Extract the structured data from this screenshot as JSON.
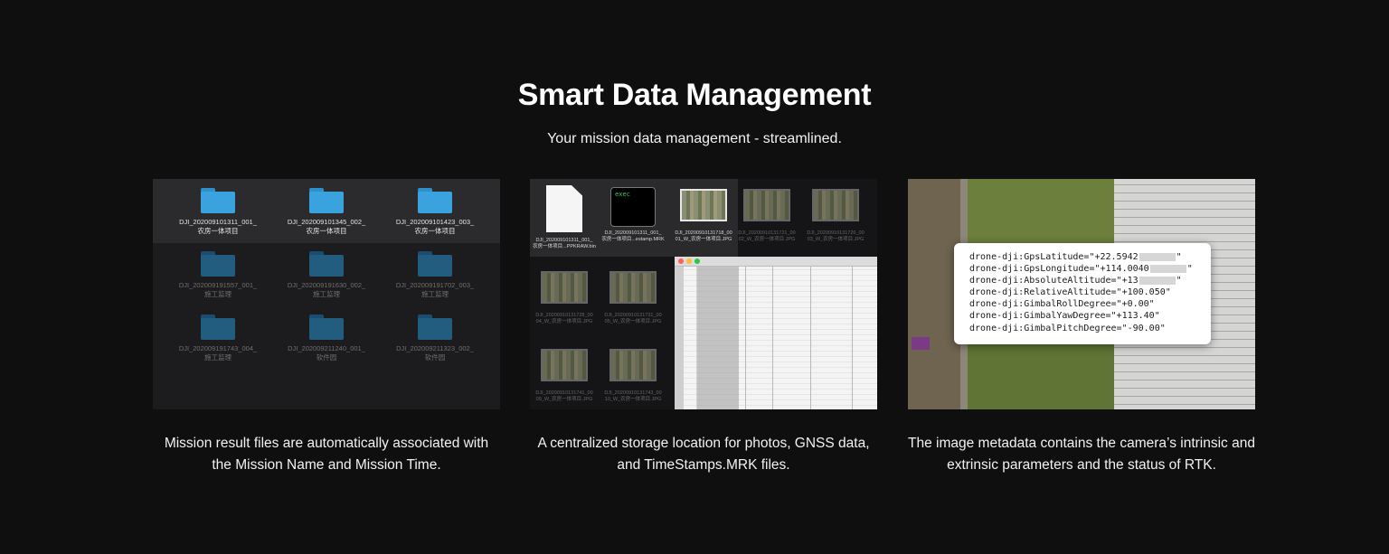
{
  "header": {
    "title": "Smart Data Management",
    "subtitle": "Your mission data management - streamlined."
  },
  "panels": [
    {
      "caption": "Mission result files are automatically associated with the Mission Name and Mission Time.",
      "folders": [
        {
          "name": "DJI_202009101311_001_",
          "sub": "农房一体项目",
          "selected": true
        },
        {
          "name": "DJI_202009101345_002_",
          "sub": "农房一体项目",
          "selected": true
        },
        {
          "name": "DJI_202009101423_003_",
          "sub": "农房一体项目",
          "selected": true
        },
        {
          "name": "DJI_202009191557_001_",
          "sub": "施工监理",
          "selected": false
        },
        {
          "name": "DJI_202009191630_002_",
          "sub": "施工监理",
          "selected": false
        },
        {
          "name": "DJI_202009191702_003_",
          "sub": "施工监理",
          "selected": false
        },
        {
          "name": "DJI_202009191743_004_",
          "sub": "施工监理",
          "selected": false
        },
        {
          "name": "DJI_202009211240_001_",
          "sub": "软件园",
          "selected": false
        },
        {
          "name": "DJI_202009211323_002_",
          "sub": "软件园",
          "selected": false
        }
      ]
    },
    {
      "caption": "A centralized storage location for photos, GNSS data, and TimeStamps.MRK files.",
      "files": [
        {
          "name": "DJI_202009101311_001_",
          "sub": "农房一体项目...PPKRAW.bin"
        },
        {
          "name": "DJI_202009101311_001_",
          "sub": "农房一体项目...estamp.MRK"
        },
        {
          "name": "DJI_20200910131718_00",
          "sub": "01_W_农房一体项目.JPG"
        },
        {
          "name": "DJI_20200910131721_00",
          "sub": "02_W_农房一体项目.JPG"
        },
        {
          "name": "DJI_20200910131726_00",
          "sub": "03_W_农房一体项目.JPG"
        },
        {
          "name": "DJI_20200910131728_00",
          "sub": "04_W_农房一体项目.JPG"
        },
        {
          "name": "DJI_20200910131731_00",
          "sub": "05_W_农房一体项目.JPG"
        },
        {
          "name": "DJI_20200910131741_00",
          "sub": "09_W_农房一体项目.JPG"
        },
        {
          "name": "DJI_20200910131743_00",
          "sub": "10_W_农房一体项目.JPG"
        }
      ],
      "terminal_text": "exec"
    },
    {
      "caption": "The image metadata contains the camera’s intrinsic and extrinsic parameters and the status of RTK.",
      "metadata": [
        {
          "prefix": "drone-dji:GpsLatitude=\"+22.5942",
          "masked": true,
          "suffix": "\""
        },
        {
          "prefix": "drone-dji:GpsLongitude=\"+114.0040",
          "masked": true,
          "suffix": "\""
        },
        {
          "prefix": "drone-dji:AbsoluteAltitude=\"+13",
          "masked": true,
          "suffix": "\""
        },
        {
          "prefix": "drone-dji:RelativeAltitude=\"+100.050\"",
          "masked": false,
          "suffix": ""
        },
        {
          "prefix": "drone-dji:GimbalRollDegree=\"+0.00\"",
          "masked": false,
          "suffix": ""
        },
        {
          "prefix": "drone-dji:GimbalYawDegree=\"+113.40\"",
          "masked": false,
          "suffix": ""
        },
        {
          "prefix": "drone-dji:GimbalPitchDegree=\"-90.00\"",
          "masked": false,
          "suffix": ""
        }
      ]
    }
  ],
  "colors": {
    "background": "#0f0f10",
    "folder_blue": "#3aa3df",
    "terminal_green": "#3ec65b"
  }
}
